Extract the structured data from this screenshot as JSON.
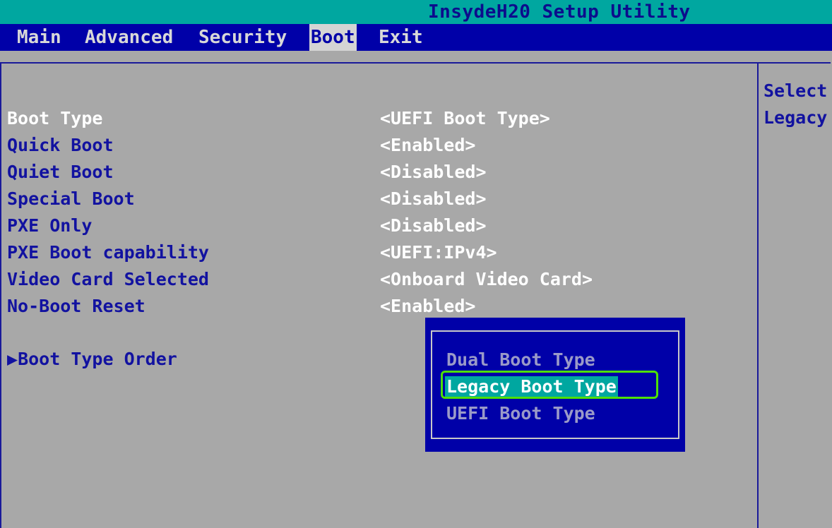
{
  "title": "InsydeH20 Setup Utility",
  "menu": [
    {
      "label": "Main"
    },
    {
      "label": "Advanced"
    },
    {
      "label": "Security"
    },
    {
      "label": "Boot",
      "active": true
    },
    {
      "label": "Exit"
    }
  ],
  "settings": [
    {
      "label": "Boot Type",
      "value": "<UEFI Boot Type>"
    },
    {
      "label": "Quick Boot",
      "value": "<Enabled>"
    },
    {
      "label": "Quiet Boot",
      "value": "<Disabled>"
    },
    {
      "label": "Special Boot",
      "value": "<Disabled>"
    },
    {
      "label": "PXE Only",
      "value": "<Disabled>"
    },
    {
      "label": "PXE Boot capability",
      "value": "<UEFI:IPv4>"
    },
    {
      "label": "Video Card Selected",
      "value": "<Onboard Video Card>"
    },
    {
      "label": "No-Boot Reset",
      "value": "<Enabled>"
    }
  ],
  "submenu": {
    "arrow": "▶",
    "label": "Boot Type Order"
  },
  "popup": {
    "options": [
      {
        "label": "Dual Boot Type"
      },
      {
        "label": "Legacy Boot Type",
        "highlighted": true
      },
      {
        "label": "UEFI Boot Type"
      }
    ]
  },
  "help": {
    "line1": "Select",
    "line2": "Legacy"
  },
  "colors": {
    "highlight_outline": "#4ee000",
    "menubar": "#0000a8",
    "titlebar": "#00a7a0"
  }
}
